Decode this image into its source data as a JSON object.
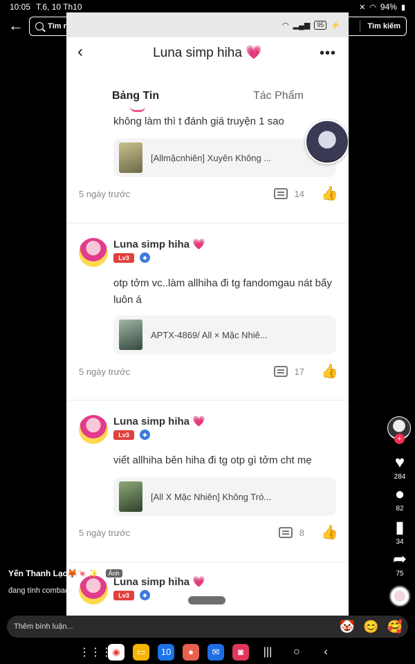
{
  "status_bar": {
    "time": "10:05",
    "date": "T.6, 10 Th10",
    "battery": "94%"
  },
  "search": {
    "placeholder": "Tìm nội dung liên quan",
    "submit_label": "Tìm kiếm"
  },
  "profile": {
    "title": "Luna simp hiha",
    "tabs": [
      "Bảng Tin",
      "Tác Phẩm"
    ],
    "battery": "95"
  },
  "posts": [
    {
      "text": "không làm thì t đánh giá truyện 1 sao",
      "attachment": "[Allmặcnhiên] Xuyên Không ...",
      "time": "5 ngày trước",
      "comments": "14"
    },
    {
      "author": "Luna simp hiha",
      "level": "Lv3",
      "text": "otp tởm vc..làm allhiha đi tg fandomgau nát bấy luôn á",
      "attachment": "APTX-4869/ All × Mặc Nhiê...",
      "time": "5 ngày trước",
      "comments": "17"
    },
    {
      "author": "Luna simp hiha",
      "level": "Lv3",
      "text": "viết allhiha bên hiha đi tg otp gì tởm cht mẹ",
      "attachment": "[All X Mặc Nhiên] Không Tró...",
      "time": "5 ngày trước",
      "comments": "8"
    },
    {
      "author": "Luna simp hiha",
      "level": "Lv3"
    }
  ],
  "rail": {
    "likes": "284",
    "comments": "82",
    "saves": "34",
    "shares": "75"
  },
  "caption": {
    "username": "Yến Thanh Lạc🦊🍬✨",
    "tag": "Ảnh",
    "description": "đang tính comback"
  },
  "comment_bar": {
    "placeholder": "Thêm bình luận..."
  },
  "colors": {
    "accent_pink": "#f0528f",
    "tiktok_red": "#fe2c55",
    "level_red": "#e0413e"
  }
}
